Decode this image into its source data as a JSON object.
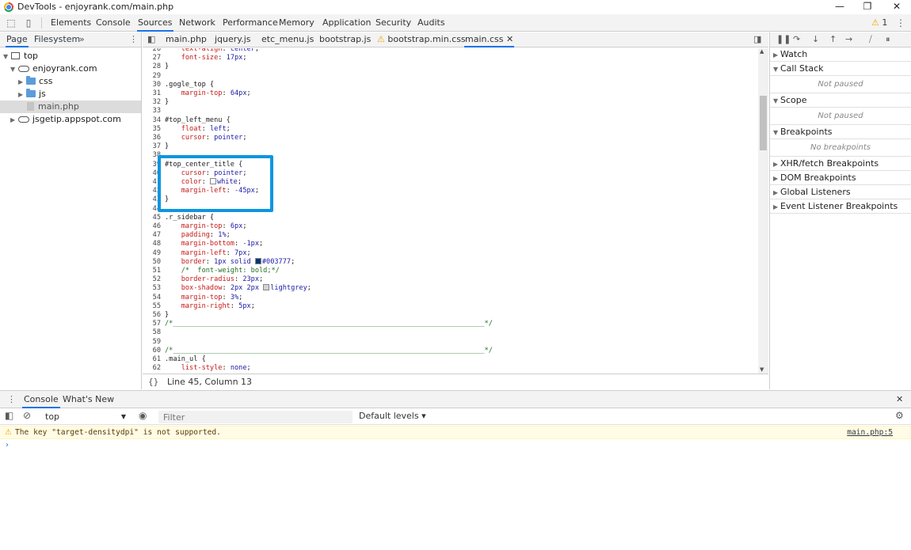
{
  "window": {
    "title": "DevTools - enjoyrank.com/main.php",
    "minimize": "—",
    "maximize": "❐",
    "close": "✕"
  },
  "main_tabs": [
    "Elements",
    "Console",
    "Sources",
    "Network",
    "Performance",
    "Memory",
    "Application",
    "Security",
    "Audits"
  ],
  "active_main_tab": "Sources",
  "warning_count": "1",
  "navigator": {
    "tabs": [
      "Page",
      "Filesystem"
    ],
    "more": "»",
    "tree": {
      "top": "top",
      "domain": "enjoyrank.com",
      "css": "css",
      "js": "js",
      "file": "main.php",
      "other": "jsgetip.appspot.com"
    }
  },
  "editor": {
    "tabs": [
      "main.php",
      "jquery.js",
      "etc_menu.js",
      "bootstrap.js",
      "bootstrap.min.css",
      "main.css"
    ],
    "active_tab": "main.css",
    "status": "Line 45, Column 13",
    "lines": [
      {
        "n": "26",
        "t": "    text-align: center;"
      },
      {
        "n": "27",
        "t": "    font-size: 17px;"
      },
      {
        "n": "28",
        "t": "}"
      },
      {
        "n": "29",
        "t": ""
      },
      {
        "n": "30",
        "t": ".gogle_top {"
      },
      {
        "n": "31",
        "t": "    margin-top: 64px;"
      },
      {
        "n": "32",
        "t": "}"
      },
      {
        "n": "33",
        "t": ""
      },
      {
        "n": "34",
        "t": "#top_left_menu {"
      },
      {
        "n": "35",
        "t": "    float: left;"
      },
      {
        "n": "36",
        "t": "    cursor: pointer;"
      },
      {
        "n": "37",
        "t": "}"
      },
      {
        "n": "38",
        "t": ""
      },
      {
        "n": "39",
        "t": "#top_center_title {"
      },
      {
        "n": "40",
        "t": "    cursor: pointer;"
      },
      {
        "n": "41",
        "t": "    color: white;"
      },
      {
        "n": "42",
        "t": "    margin-left: -45px;"
      },
      {
        "n": "43",
        "t": "}"
      },
      {
        "n": "44",
        "t": ""
      },
      {
        "n": "45",
        "t": ".r_sidebar {"
      },
      {
        "n": "46",
        "t": "    margin-top: 6px;"
      },
      {
        "n": "47",
        "t": "    padding: 1%;"
      },
      {
        "n": "48",
        "t": "    margin-bottom: -1px;"
      },
      {
        "n": "49",
        "t": "    margin-left: 7px;"
      },
      {
        "n": "50",
        "t": "    border: 1px solid #003777;"
      },
      {
        "n": "51",
        "t": "    /*  font-weight: bold;*/"
      },
      {
        "n": "52",
        "t": "    border-radius: 23px;"
      },
      {
        "n": "53",
        "t": "    box-shadow: 2px 2px lightgrey;"
      },
      {
        "n": "54",
        "t": "    margin-top: 3%;"
      },
      {
        "n": "55",
        "t": "    margin-right: 5px;"
      },
      {
        "n": "56",
        "t": "}"
      },
      {
        "n": "57",
        "t": "/*____________________________________________________________________________*/"
      },
      {
        "n": "58",
        "t": ""
      },
      {
        "n": "59",
        "t": ""
      },
      {
        "n": "60",
        "t": "/*____________________________________________________________________________*/"
      },
      {
        "n": "61",
        "t": ".main_ul {"
      },
      {
        "n": "62",
        "t": "    list-style: none;"
      }
    ]
  },
  "debugger": {
    "sections": {
      "watch": "Watch",
      "call_stack": "Call Stack",
      "call_stack_empty": "Not paused",
      "scope": "Scope",
      "scope_empty": "Not paused",
      "breakpoints": "Breakpoints",
      "breakpoints_empty": "No breakpoints",
      "xhr": "XHR/fetch Breakpoints",
      "dom": "DOM Breakpoints",
      "global": "Global Listeners",
      "event": "Event Listener Breakpoints"
    }
  },
  "drawer": {
    "tabs": [
      "Console",
      "What's New"
    ],
    "context": "top",
    "filter_placeholder": "Filter",
    "levels": "Default levels ▾",
    "warning_message": "The key \"target-densitydpi\" is not supported.",
    "warning_source": "main.php:5",
    "prompt": "›"
  },
  "colors": {
    "accent": "#1a73e8",
    "highlight_box": "#0d96e0",
    "warning_bg": "#fffbe5",
    "swatch_navy": "#003777",
    "swatch_lightgrey": "#d3d3d3"
  }
}
